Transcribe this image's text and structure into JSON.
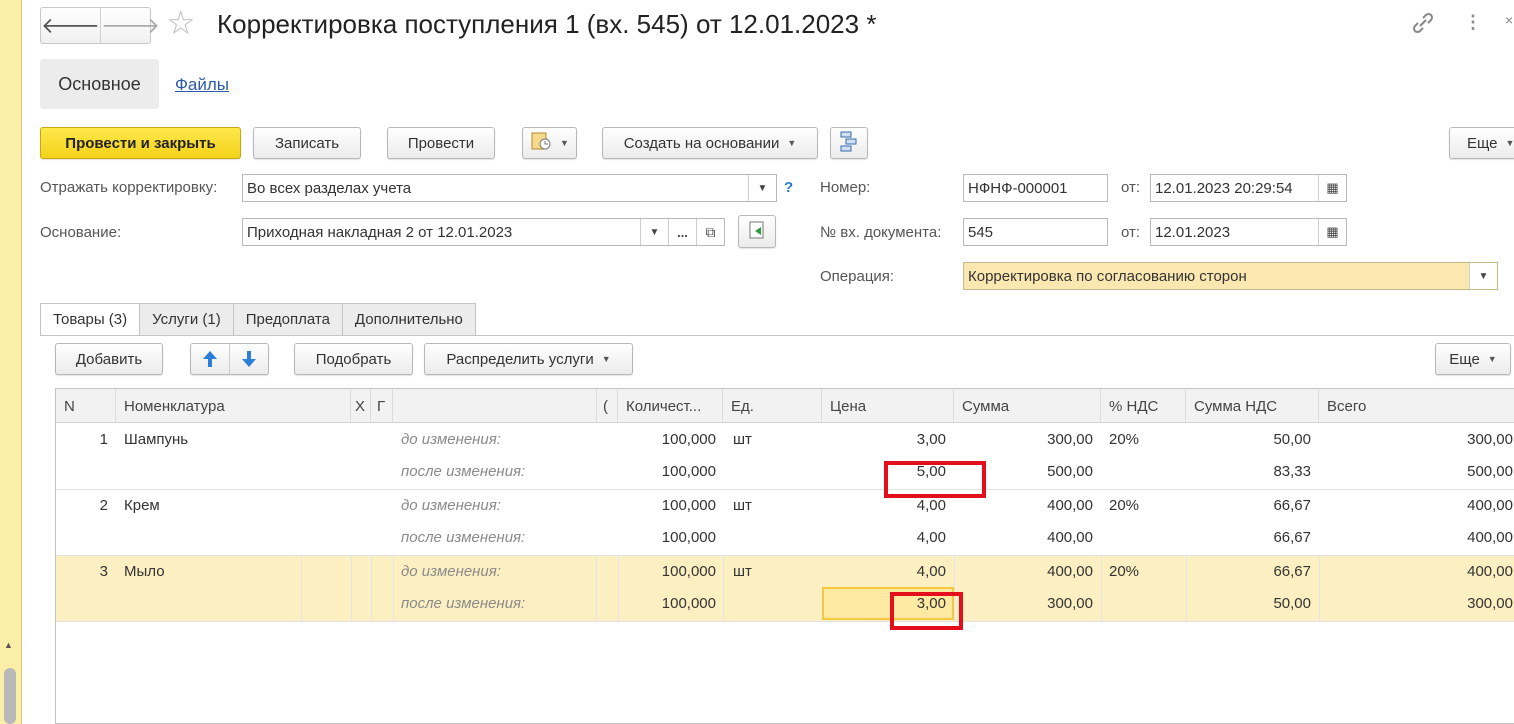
{
  "window": {
    "title": "Корректировка поступления 1 (вх. 545) от 12.01.2023 *",
    "back_icon": "arrow-left-icon",
    "forward_icon": "arrow-right-icon"
  },
  "sections": {
    "main": "Основное",
    "files": "Файлы"
  },
  "toolbar": {
    "post_close": "Провести и закрыть",
    "save": "Записать",
    "post": "Провести",
    "create_basis": "Создать на основании",
    "more": "Еще"
  },
  "form": {
    "reflect_label": "Отражать корректировку:",
    "reflect_value": "Во всех разделах учета",
    "basis_label": "Основание:",
    "basis_value": "Приходная накладная 2 от 12.01.2023",
    "number_label": "Номер:",
    "number_value": "НФНФ-000001",
    "from_label": "от:",
    "date_value": "12.01.2023 20:29:54",
    "in_doc_label": "№ вх. документа:",
    "in_doc_value": "545",
    "in_date_value": "12.01.2023",
    "operation_label": "Операция:",
    "operation_value": "Корректировка по согласованию сторон",
    "help": "?",
    "dots": "..."
  },
  "tabs": [
    "Товары (3)",
    "Услуги (1)",
    "Предоплата",
    "Дополнительно"
  ],
  "table_toolbar": {
    "add": "Добавить",
    "pick": "Подобрать",
    "distribute": "Распределить услуги",
    "more": "Еще"
  },
  "table": {
    "headers": {
      "n": "N",
      "nomenclature": "Номенклатура",
      "h1": "Х",
      "h2": "Г",
      "h3": "(",
      "qty": "Количест...",
      "unit": "Ед.",
      "price": "Цена",
      "sum": "Сумма",
      "vat_rate": "% НДС",
      "vat_sum": "Сумма НДС",
      "total": "Всего"
    },
    "rows": [
      {
        "n": "1",
        "name": "Шампунь",
        "unit": "шт",
        "vat_rate": "20%",
        "before": {
          "label": "до изменения:",
          "qty": "100,000",
          "price": "3,00",
          "sum": "300,00",
          "vat_sum": "50,00",
          "total": "300,00"
        },
        "after": {
          "label": "после изменения:",
          "qty": "100,000",
          "price": "5,00",
          "sum": "500,00",
          "vat_sum": "83,33",
          "total": "500,00"
        }
      },
      {
        "n": "2",
        "name": "Крем",
        "unit": "шт",
        "vat_rate": "20%",
        "before": {
          "label": "до изменения:",
          "qty": "100,000",
          "price": "4,00",
          "sum": "400,00",
          "vat_sum": "66,67",
          "total": "400,00"
        },
        "after": {
          "label": "после изменения:",
          "qty": "100,000",
          "price": "4,00",
          "sum": "400,00",
          "vat_sum": "66,67",
          "total": "400,00"
        }
      },
      {
        "n": "3",
        "name": "Мыло",
        "unit": "шт",
        "vat_rate": "20%",
        "before": {
          "label": "до изменения:",
          "qty": "100,000",
          "price": "4,00",
          "sum": "400,00",
          "vat_sum": "66,67",
          "total": "400,00"
        },
        "after": {
          "label": "после изменения:",
          "qty": "100,000",
          "price": "3,00",
          "sum": "300,00",
          "vat_sum": "50,00",
          "total": "300,00"
        }
      }
    ]
  },
  "colors": {
    "accent_yellow": "#f4d21b",
    "highlight_row": "#fcf0c2",
    "annotation_red": "#e3101b",
    "link_blue": "#2a5aa8"
  }
}
